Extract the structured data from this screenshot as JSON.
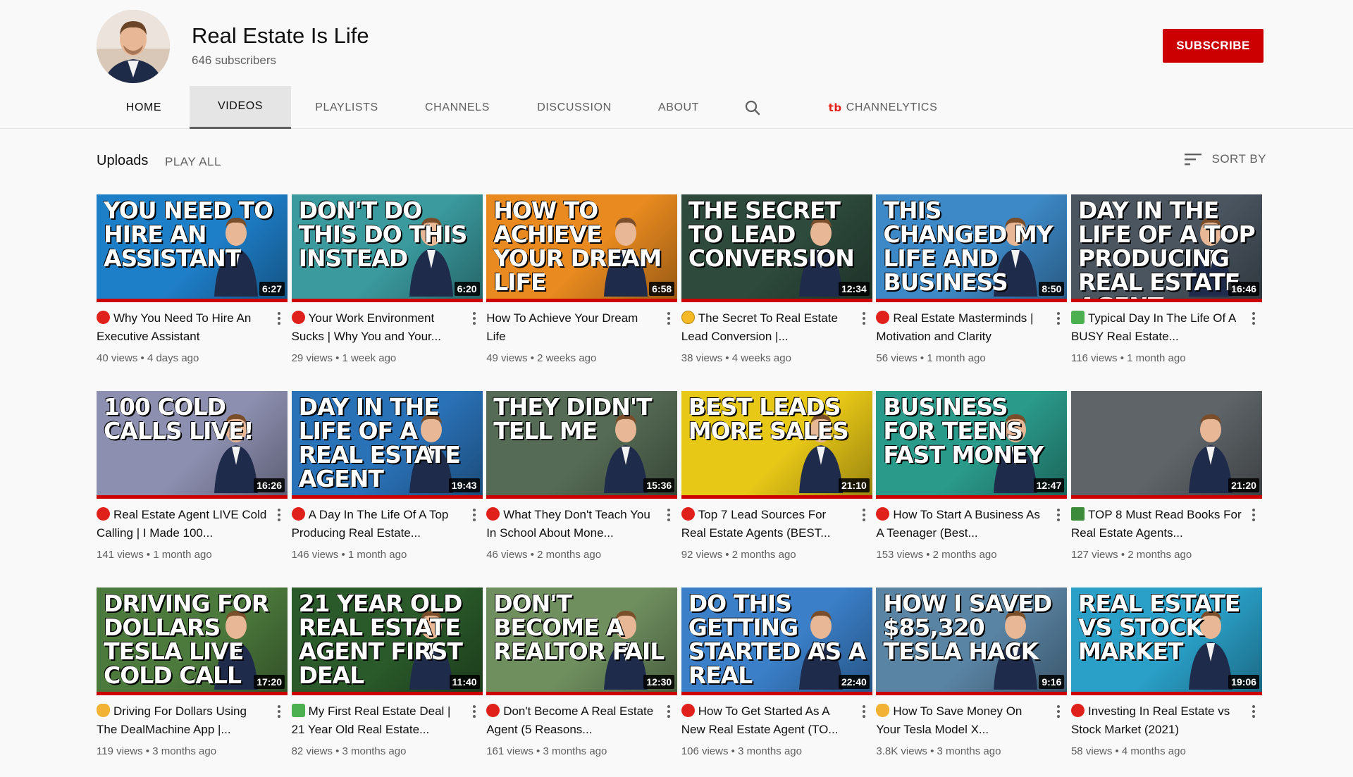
{
  "channel": {
    "name": "Real Estate Is Life",
    "subscribers": "646 subscribers",
    "subscribe_label": "SUBSCRIBE"
  },
  "tabs": [
    {
      "label": "HOME"
    },
    {
      "label": "VIDEOS"
    },
    {
      "label": "PLAYLISTS"
    },
    {
      "label": "CHANNELS"
    },
    {
      "label": "DISCUSSION"
    },
    {
      "label": "ABOUT"
    },
    {
      "label": "CHANNELYTICS",
      "logo": "tb"
    }
  ],
  "uploads": {
    "title": "Uploads",
    "play_all": "PLAY ALL",
    "sort_by": "SORT BY"
  },
  "videos": [
    {
      "thumb_text": "YOU NEED TO HIRE AN ASSISTANT",
      "duration": "6:27",
      "emoji": "red",
      "title": "Why You Need To Hire An Executive Assistant",
      "views": "40 views",
      "age": "4 days ago",
      "bg": "#1e7fc9"
    },
    {
      "thumb_text": "DON'T DO THIS    DO THIS INSTEAD",
      "duration": "6:20",
      "emoji": "red",
      "title": "Your Work Environment Sucks | Why You and Your...",
      "views": "29 views",
      "age": "1 week ago",
      "bg": "#3a9a9e"
    },
    {
      "thumb_text": "HOW TO ACHIEVE YOUR DREAM LIFE",
      "duration": "6:58",
      "emoji": "",
      "title": "How To Achieve Your Dream Life",
      "views": "49 views",
      "age": "2 weeks ago",
      "bg": "#e88a1f"
    },
    {
      "thumb_text": "THE SECRET TO LEAD CONVERSION",
      "duration": "12:34",
      "emoji": "face",
      "title": "The Secret To Real Estate Lead Conversion |...",
      "views": "38 views",
      "age": "4 weeks ago",
      "bg": "#2d4a3c"
    },
    {
      "thumb_text": "THIS CHANGED MY LIFE AND BUSINESS",
      "duration": "8:50",
      "emoji": "red",
      "title": "Real Estate Masterminds | Motivation and Clarity",
      "views": "56 views",
      "age": "1 month ago",
      "bg": "#3d89c7"
    },
    {
      "thumb_text": "DAY IN THE LIFE OF A TOP PRODUCING REAL ESTATE AGENT",
      "duration": "16:46",
      "emoji": "house",
      "title": "Typical Day In The Life Of A BUSY Real Estate...",
      "views": "116 views",
      "age": "1 month ago",
      "bg": "#4a5560"
    },
    {
      "thumb_text": "100 COLD CALLS LIVE!",
      "duration": "16:26",
      "emoji": "red",
      "title": "Real Estate Agent LIVE Cold Calling | I Made 100...",
      "views": "141 views",
      "age": "1 month ago",
      "bg": "#8d8fb0"
    },
    {
      "thumb_text": "DAY IN THE LIFE OF A REAL ESTATE AGENT",
      "duration": "19:43",
      "emoji": "red",
      "title": "A Day In The Life Of A Top Producing Real Estate...",
      "views": "146 views",
      "age": "1 month ago",
      "bg": "#2a72b8"
    },
    {
      "thumb_text": "THEY DIDN'T TELL ME",
      "duration": "15:36",
      "emoji": "red",
      "title": "What They Don't Teach You In School About Mone...",
      "views": "46 views",
      "age": "2 months ago",
      "bg": "#556b55"
    },
    {
      "thumb_text": "BEST LEADS MORE SALES",
      "duration": "21:10",
      "emoji": "red",
      "title": "Top 7 Lead Sources For Real Estate Agents (BEST...",
      "views": "92 views",
      "age": "2 months ago",
      "bg": "#e8c817"
    },
    {
      "thumb_text": "BUSINESS FOR TEENS FAST MONEY",
      "duration": "12:47",
      "emoji": "red",
      "title": "How To Start A Business As A Teenager (Best...",
      "views": "153 views",
      "age": "2 months ago",
      "bg": "#2a9a8a"
    },
    {
      "thumb_text": "",
      "duration": "21:20",
      "emoji": "book",
      "title": "TOP 8 Must Read Books For Real Estate Agents...",
      "views": "127 views",
      "age": "2 months ago",
      "bg": "#5e6468"
    },
    {
      "thumb_text": "DRIVING FOR DOLLARS TESLA LIVE COLD CALL",
      "duration": "17:20",
      "emoji": "bag",
      "title": "Driving For Dollars Using The DealMachine App |...",
      "views": "119 views",
      "age": "3 months ago",
      "bg": "#4c7a3c"
    },
    {
      "thumb_text": "21 YEAR OLD REAL ESTATE AGENT FIRST DEAL",
      "duration": "11:40",
      "emoji": "house",
      "title": "My First Real Estate Deal | 21 Year Old Real Estate...",
      "views": "82 views",
      "age": "3 months ago",
      "bg": "#2a5a2a"
    },
    {
      "thumb_text": "DON'T BECOME A REALTOR FAIL",
      "duration": "12:30",
      "emoji": "red",
      "title": "Don't Become A Real Estate Agent (5 Reasons...",
      "views": "161 views",
      "age": "3 months ago",
      "bg": "#6f8f5f"
    },
    {
      "thumb_text": "DO THIS GETTING STARTED AS A REAL",
      "duration": "22:40",
      "emoji": "red",
      "title": "How To Get Started As A New Real Estate Agent (TO...",
      "views": "106 views",
      "age": "3 months ago",
      "bg": "#3a7fc8"
    },
    {
      "thumb_text": "HOW I SAVED $85,320 TESLA HACK",
      "duration": "9:16",
      "emoji": "bag",
      "title": "How To Save Money On Your Tesla Model X...",
      "views": "3.8K views",
      "age": "3 months ago",
      "bg": "#5a84a4"
    },
    {
      "thumb_text": "REAL ESTATE VS STOCK MARKET",
      "duration": "19:06",
      "emoji": "red",
      "title": "Investing In Real Estate vs Stock Market (2021)",
      "views": "58 views",
      "age": "4 months ago",
      "bg": "#2aa0c8"
    }
  ],
  "stats_separator": " • ",
  "icons": [
    "search-icon",
    "sort-icon",
    "more-vert-icon",
    "channelytics-logo-icon"
  ]
}
